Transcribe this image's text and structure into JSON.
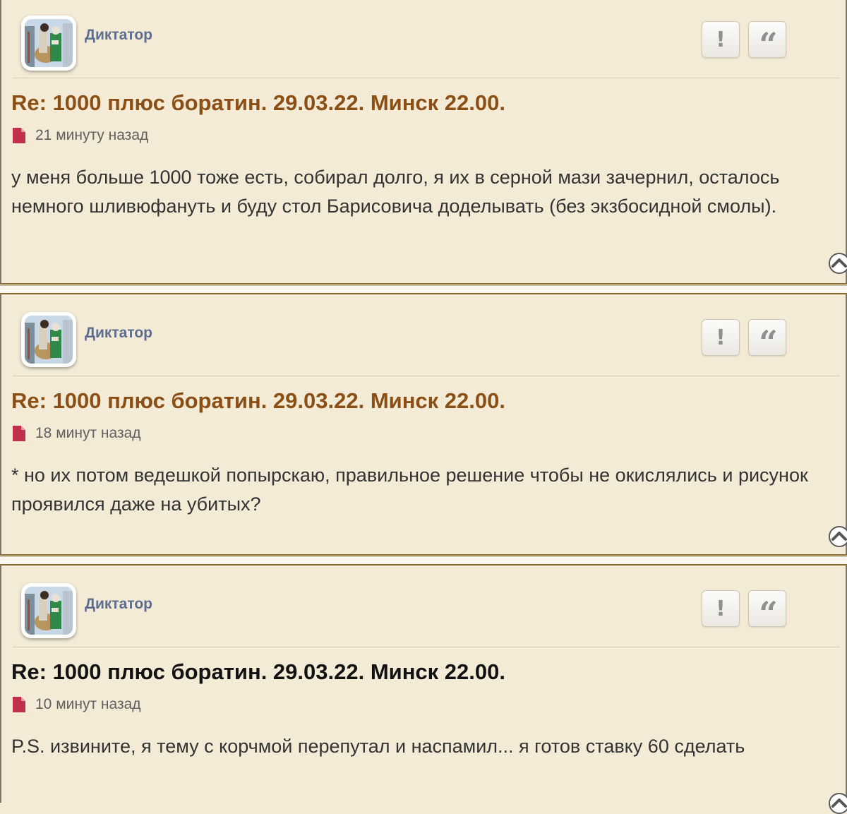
{
  "posts": [
    {
      "username": "Диктатор",
      "title": "Re: 1000 плюс боратин. 29.03.22. Минск 22.00.",
      "time": "21 минуту назад",
      "content": "у меня больше 1000 тоже есть, собирал долго, я их в серной мази зачернил, осталось немного шливюфануть и буду стол Барисовича доделывать (без экзбосидной смолы).",
      "report_icon": "!",
      "quote_icon": "“"
    },
    {
      "username": "Диктатор",
      "title": "Re: 1000 плюс боратин. 29.03.22. Минск 22.00.",
      "time": "18 минут назад",
      "content": "* но их потом ведешкой попырскаю, правильное решение чтобы не окислялись и рисунок проявился даже на убитых?",
      "report_icon": "!",
      "quote_icon": "“"
    },
    {
      "username": "Диктатор",
      "title": "Re: 1000 плюс боратин. 29.03.22. Минск 22.00.",
      "time": "10 минут назад",
      "content": "P.S. извините, я тему с корчмой перепутал и наспамил... я готов ставку 60 сделать",
      "report_icon": "!",
      "quote_icon": "“"
    }
  ],
  "icons": {
    "report": "exclamation-icon",
    "quote": "quote-icon",
    "post": "document-icon",
    "back_to_top": "chevron-up-icon"
  },
  "colors": {
    "background": "#f3ebd6",
    "title": "#8b4f16",
    "title_last": "#111111",
    "username": "#5e6c8e",
    "post_icon": "#c0304a"
  }
}
